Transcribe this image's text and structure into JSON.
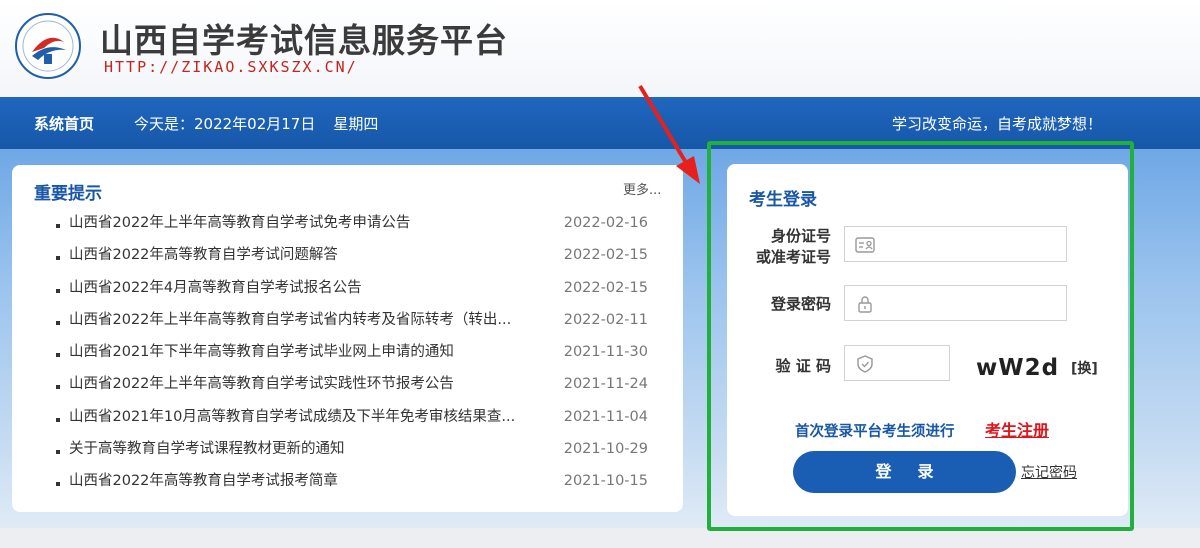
{
  "header": {
    "title": "山西自学考试信息服务平台",
    "url": "HTTP://ZIKAO.SXKSZX.CN/",
    "logo_icon": "exam-logo-icon"
  },
  "nav": {
    "home": "系统首页",
    "date_prefix": "今天是：2022年02月17日",
    "weekday": "星期四",
    "slogan": "学习改变命运，自考成就梦想！"
  },
  "notices": {
    "title": "重要提示",
    "more": "更多...",
    "items": [
      {
        "title": "山西省2022年上半年高等教育自学考试免考申请公告",
        "date": "2022-02-16"
      },
      {
        "title": "山西省2022年高等教育自学考试问题解答",
        "date": "2022-02-15"
      },
      {
        "title": "山西省2022年4月高等教育自学考试报名公告",
        "date": "2022-02-15"
      },
      {
        "title": "山西省2022年上半年高等教育自学考试省内转考及省际转考（转出...",
        "date": "2022-02-11"
      },
      {
        "title": "山西省2021年下半年高等教育自学考试毕业网上申请的通知",
        "date": "2021-11-30"
      },
      {
        "title": "山西省2022年上半年高等教育自学考试实践性环节报考公告",
        "date": "2021-11-24"
      },
      {
        "title": "山西省2021年10月高等教育自学考试成绩及下半年免考审核结果查...",
        "date": "2021-11-04"
      },
      {
        "title": "关于高等教育自学考试课程教材更新的通知",
        "date": "2021-10-29"
      },
      {
        "title": "山西省2022年高等教育自学考试报考简章",
        "date": "2021-10-15"
      }
    ]
  },
  "login": {
    "title": "考生登录",
    "id_label_line1": "身份证号",
    "id_label_line2": "或准考证号",
    "id_value": "",
    "password_label": "登录密码",
    "password_value": "",
    "captcha_label": "验 证 码",
    "captcha_value": "",
    "captcha_text": "wW2d",
    "captcha_refresh": "[换]",
    "register_hint": "首次登录平台考生须进行",
    "register_link": "考生注册",
    "login_button": "登录",
    "forgot_password": "忘记密码"
  },
  "colors": {
    "brand_blue": "#1a5eb3",
    "highlight_green": "#21b03a",
    "alert_red": "#e0141b"
  }
}
